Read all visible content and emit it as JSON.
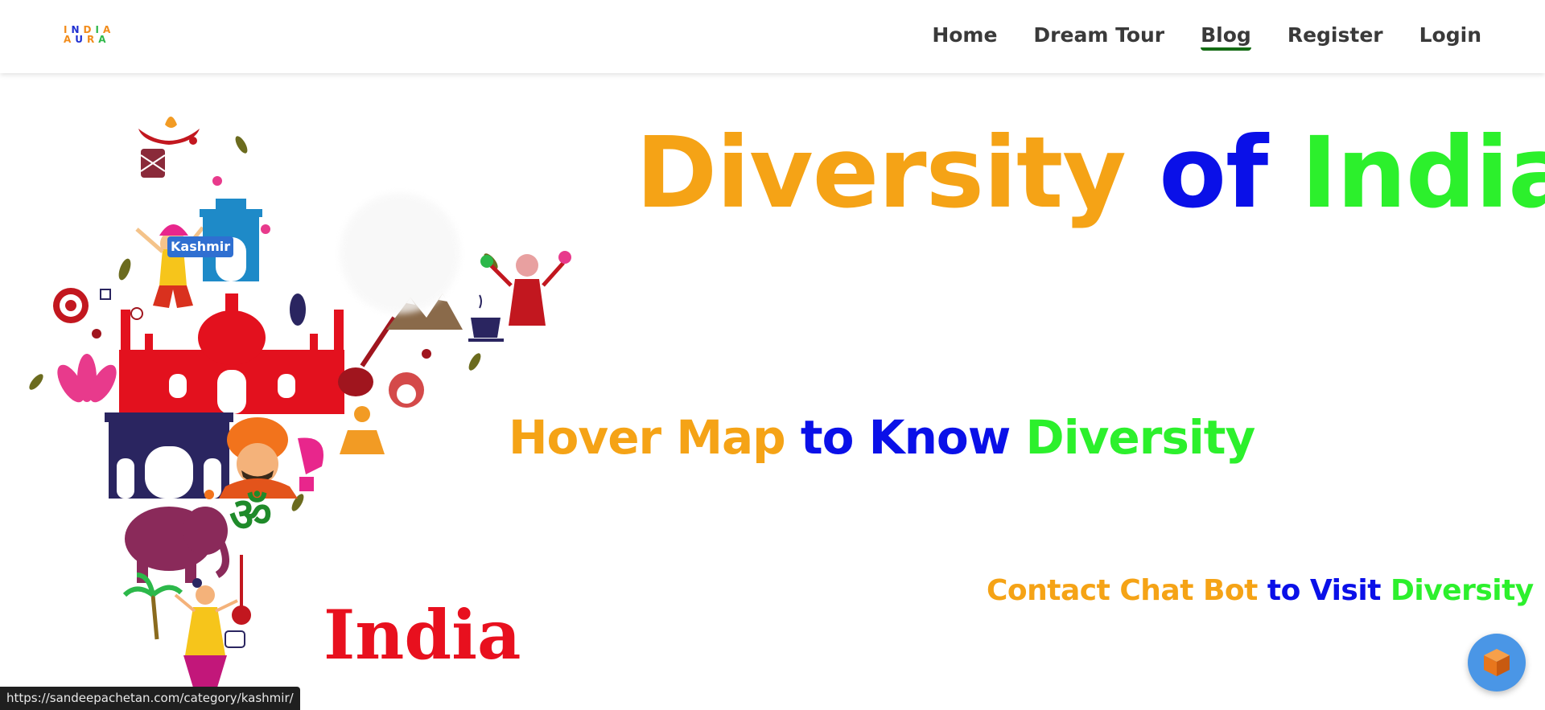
{
  "header": {
    "logo": {
      "line1": [
        "I",
        "N",
        "D",
        "I",
        "A"
      ],
      "line2": [
        "A",
        "U",
        "R",
        "A"
      ],
      "line1_colors": [
        "#f28c1b",
        "#1f2fd1",
        "#f28c1b",
        "#2fb84a",
        "#f28c1b"
      ],
      "line2_colors": [
        "#f28c1b",
        "#1f2fd1",
        "#f28c1b",
        "#2fb84a"
      ]
    },
    "nav": [
      {
        "label": "Home",
        "active": false
      },
      {
        "label": "Dream Tour",
        "active": false
      },
      {
        "label": "Blog",
        "active": true
      },
      {
        "label": "Register",
        "active": false
      },
      {
        "label": "Login",
        "active": false
      }
    ]
  },
  "map": {
    "tooltip": "Kashmir",
    "india_word": "India",
    "icons": [
      "diya-icon",
      "dhol-icon",
      "dancer-icon",
      "india-gate-icon",
      "lotus-icon",
      "taj-mahal-icon",
      "gateway-of-india-icon",
      "turban-man-icon",
      "yoga-icon",
      "om-icon",
      "elephant-icon",
      "sitar-icon",
      "tea-cup-icon",
      "mountains-icon",
      "tribal-dancer-icon",
      "kathakali-icon",
      "palm-tree-icon",
      "classical-dancer-icon"
    ]
  },
  "main": {
    "hero": [
      {
        "text": "Diversity",
        "color": "#f5a316"
      },
      {
        "text": "of",
        "color": "#0a10e8"
      },
      {
        "text": "India",
        "color": "#2cf02c"
      }
    ],
    "hover": [
      {
        "text": "Hover Map",
        "color": "#f5a316"
      },
      {
        "text": "to Know",
        "color": "#0a10e8"
      },
      {
        "text": "Diversity",
        "color": "#2cf02c"
      }
    ],
    "contact": [
      {
        "text": "Contact Chat Bot",
        "color": "#f5a316"
      },
      {
        "text": "to Visit",
        "color": "#0a10e8"
      },
      {
        "text": "Diversity",
        "color": "#2cf02c"
      }
    ]
  },
  "status": {
    "url": "https://sandeepachetan.com/category/kashmir/"
  },
  "chat": {
    "icon": "cube-icon",
    "button_color": "#4a96e6"
  }
}
